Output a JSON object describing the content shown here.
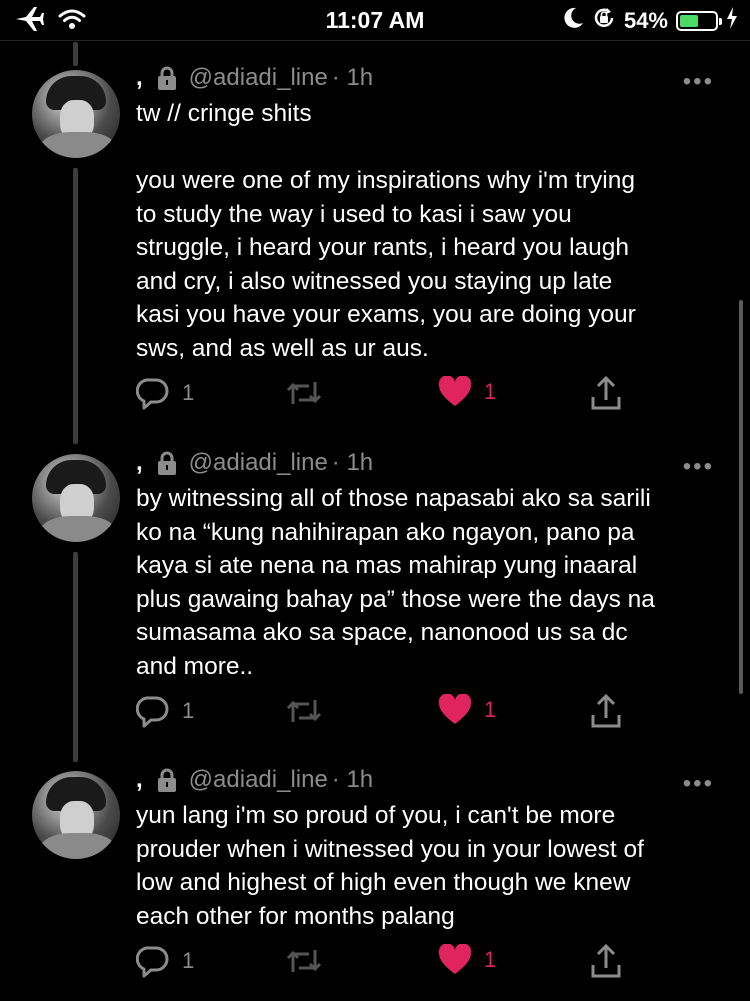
{
  "status_bar": {
    "time": "11:07 AM",
    "battery_percent": "54%",
    "battery_level": 0.54,
    "battery_color": "#4cd964"
  },
  "colors": {
    "background": "#000000",
    "muted": "#8c8c8c",
    "like": "#e0245e",
    "thread": "#3d3d3d"
  },
  "tweets": [
    {
      "prefix": ",",
      "handle": "@adiadi_line",
      "time": "· 1h",
      "more": "•••",
      "text": "tw // cringe shits\n\nyou were one of my inspirations why i'm trying\nto study the way i used to kasi i saw you\nstruggle, i heard your rants, i heard you laugh\nand cry, i also witnessed you staying up late\nkasi you have your exams, you are doing your\nsws, and as well as ur aus.",
      "replies": "1",
      "likes": "1"
    },
    {
      "prefix": ",",
      "handle": "@adiadi_line",
      "time": "· 1h",
      "more": "•••",
      "text": "by witnessing all of those napasabi ako sa sarili\nko na “kung nahihirapan ako ngayon, pano pa\nkaya si ate nena na mas mahirap yung inaaral\nplus gawaing bahay pa” those were the days na\nsumasama ako sa space, nanonood us sa dc\nand more..",
      "replies": "1",
      "likes": "1"
    },
    {
      "prefix": ",",
      "handle": "@adiadi_line",
      "time": "· 1h",
      "more": "•••",
      "text": "yun lang i'm so proud of you, i can't be more\nprouder when i witnessed you in your lowest of\nlow and highest of high even though we knew\neach other for months palang",
      "replies": "1",
      "likes": "1"
    }
  ],
  "icons": [
    "airplane-icon",
    "wifi-icon",
    "moon-icon",
    "rotation-lock-icon",
    "battery-icon",
    "charging-icon",
    "lock-icon",
    "reply-icon",
    "retweet-icon",
    "heart-icon",
    "share-icon"
  ]
}
